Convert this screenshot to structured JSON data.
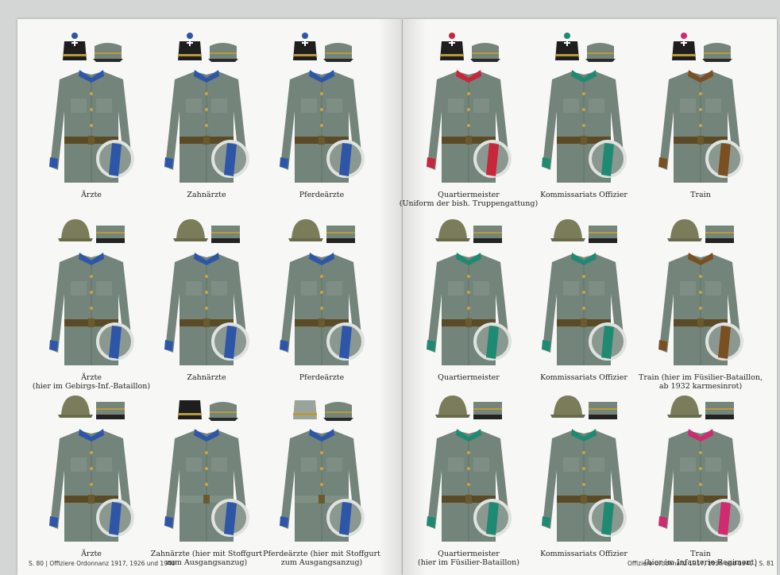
{
  "footer": {
    "left": "S. 80  |  Offiziere Ordonnanz 1917, 1926 und 1940",
    "right": "Offiziere Ordonnanz 1917, 1926 und 1940  |  S. 81"
  },
  "figures": [
    {
      "caption": "Ärzte",
      "hat": "kepi",
      "accent": "#2e56a8",
      "cap": "#2e56a8",
      "belt": "leather"
    },
    {
      "caption": "Zahnärzte",
      "hat": "kepi",
      "accent": "#2e56a8",
      "cap": "#2e56a8",
      "belt": "leather"
    },
    {
      "caption": "Pferdeärzte",
      "hat": "kepi",
      "accent": "#2e56a8",
      "cap": "#2e56a8",
      "belt": "leather"
    },
    {
      "caption": "Quartiermeister\n(Uniform der bish. Truppengattung)",
      "hat": "kepi",
      "accent": "#c8263a",
      "cap": "#c8263a",
      "belt": "leather"
    },
    {
      "caption": "Kommissariats Offizier",
      "hat": "kepi",
      "accent": "#1f8a72",
      "cap": "#1f8a72",
      "belt": "leather"
    },
    {
      "caption": "Train",
      "hat": "kepi",
      "accent": "#7a4f22",
      "cap": "#d02a70",
      "belt": "leather"
    },
    {
      "caption": "Ärzte\n(hier im Gebirgs-Inf.-Bataillon)",
      "hat": "helmet",
      "accent": "#2e56a8",
      "cap": "",
      "belt": "leather"
    },
    {
      "caption": "Zahnärzte",
      "hat": "helmet",
      "accent": "#2e56a8",
      "cap": "",
      "belt": "leather"
    },
    {
      "caption": "Pferdeärzte",
      "hat": "helmet",
      "accent": "#2e56a8",
      "cap": "",
      "belt": "leather"
    },
    {
      "caption": "Quartiermeister",
      "hat": "helmet",
      "accent": "#1f8a72",
      "cap": "",
      "belt": "leather"
    },
    {
      "caption": "Kommissariats Offizier",
      "hat": "helmet",
      "accent": "#1f8a72",
      "cap": "",
      "belt": "leather"
    },
    {
      "caption": "Train (hier im Füsilier-Bataillon,\nab 1932 karmesinrot)",
      "hat": "helmet",
      "accent": "#7a4f22",
      "cap": "",
      "belt": "leather"
    },
    {
      "caption": "Ärzte",
      "hat": "helmet",
      "accent": "#2e56a8",
      "cap": "",
      "belt": "leather"
    },
    {
      "caption": "Zahnärzte (hier mit Stoffgurt\nzum Ausgangsanzug)",
      "hat": "kepi2",
      "accent": "#2e56a8",
      "cap": "",
      "belt": "cloth"
    },
    {
      "caption": "Pferdeärzte (hier mit Stoffgurt\nzum Ausgangsanzug)",
      "hat": "kepi3",
      "accent": "#2e56a8",
      "cap": "",
      "belt": "cloth"
    },
    {
      "caption": "Quartiermeister\n(hier im Füsilier-Bataillon)",
      "hat": "helmet",
      "accent": "#1f8a72",
      "cap": "",
      "belt": "leather"
    },
    {
      "caption": "Kommissariats Offizier",
      "hat": "helmet",
      "accent": "#1f8a72",
      "cap": "",
      "belt": "leather"
    },
    {
      "caption": "Train\n(hier im Infanterie-Regiment)",
      "hat": "helmet",
      "accent": "#d02a70",
      "cap": "",
      "belt": "leather"
    }
  ],
  "colors": {
    "jacket": "#73847a",
    "jacket_light": "#8a988f",
    "belt": "#5b4a26",
    "hat_olive": "#7b7d5a",
    "kepi_black": "#1e1e1e"
  }
}
